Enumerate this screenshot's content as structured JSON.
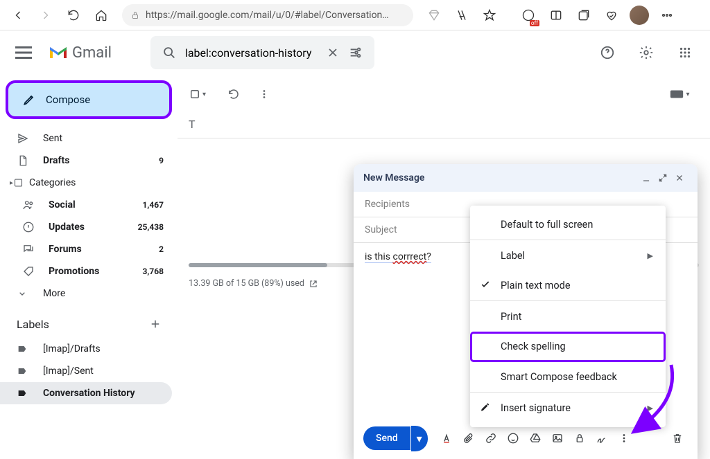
{
  "browser": {
    "url": "https://mail.google.com/mail/u/0/#label/Conversation…"
  },
  "header": {
    "brand": "Gmail",
    "search_value": "label:conversation-history"
  },
  "sidebar": {
    "compose": "Compose",
    "items": [
      {
        "icon": "send",
        "label": "Sent",
        "count": "",
        "bold": false
      },
      {
        "icon": "draft",
        "label": "Drafts",
        "count": "9",
        "bold": true
      },
      {
        "icon": "categories",
        "label": "Categories",
        "count": "",
        "bold": false
      }
    ],
    "sub": [
      {
        "icon": "social",
        "label": "Social",
        "count": "1,467",
        "bold": true
      },
      {
        "icon": "updates",
        "label": "Updates",
        "count": "25,438",
        "bold": true
      },
      {
        "icon": "forums",
        "label": "Forums",
        "count": "2",
        "bold": true
      },
      {
        "icon": "promotions",
        "label": "Promotions",
        "count": "3,768",
        "bold": true
      }
    ],
    "more": "More",
    "labels_header": "Labels",
    "labels": [
      {
        "label": "[Imap]/Drafts",
        "active": false
      },
      {
        "label": "[Imap]/Sent",
        "active": false
      },
      {
        "label": "Conversation History",
        "active": true
      }
    ]
  },
  "content": {
    "tab_t": "T",
    "storage": "13.39 GB of 15 GB (89%) used"
  },
  "compose": {
    "title": "New Message",
    "recipients": "Recipients",
    "subject": "Subject",
    "body_prefix": "is this ",
    "body_misspell": "corrrect",
    "body_suffix": "?",
    "send": "Send"
  },
  "menu": {
    "items": [
      "Default to full screen",
      "Label",
      "Plain text mode",
      "Print",
      "Check spelling",
      "Smart Compose feedback",
      "Insert signature"
    ]
  }
}
